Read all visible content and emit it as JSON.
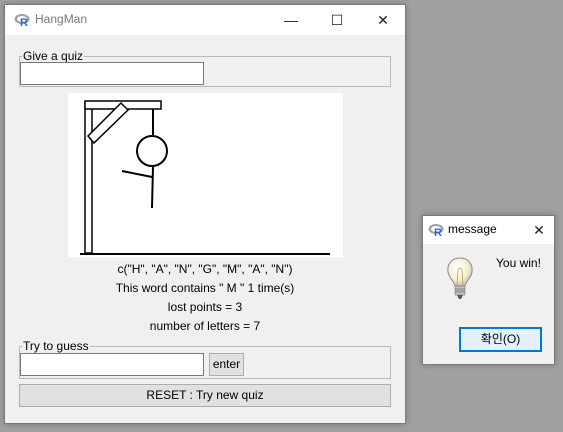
{
  "main_window": {
    "title": "HangMan",
    "controls": {
      "minimize": "—",
      "maximize": "☐",
      "close": "✕"
    },
    "quiz_group": {
      "legend": "Give a quiz",
      "input_value": ""
    },
    "info": {
      "vector": "c(\"H\", \"A\", \"N\", \"G\", \"M\", \"A\", \"N\")",
      "contains": "This word contains \" M \" 1 time(s)",
      "lost_points": "lost points = 3",
      "num_letters": "number of letters = 7"
    },
    "guess_group": {
      "legend": "Try to guess",
      "input_value": "",
      "enter_label": "enter"
    },
    "reset_label": "RESET : Try new quiz"
  },
  "message_dialog": {
    "title": "message",
    "close": "✕",
    "icon": "lightbulb-icon",
    "text": "You win!",
    "ok_label": "확인(O)"
  }
}
